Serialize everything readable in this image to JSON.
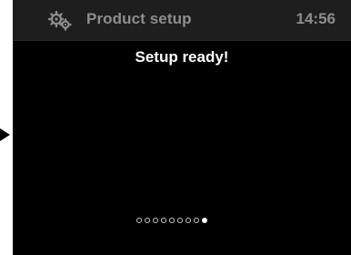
{
  "header": {
    "icon": "gears-icon",
    "title": "Product setup",
    "time": "14:56"
  },
  "main": {
    "message": "Setup ready!"
  },
  "pager": {
    "total": 9,
    "active_index": 8
  },
  "colors": {
    "screen_background": "#000000",
    "header_background": "#1e1e1e",
    "header_text": "#8d8d8d",
    "message_text": "#ffffff"
  }
}
